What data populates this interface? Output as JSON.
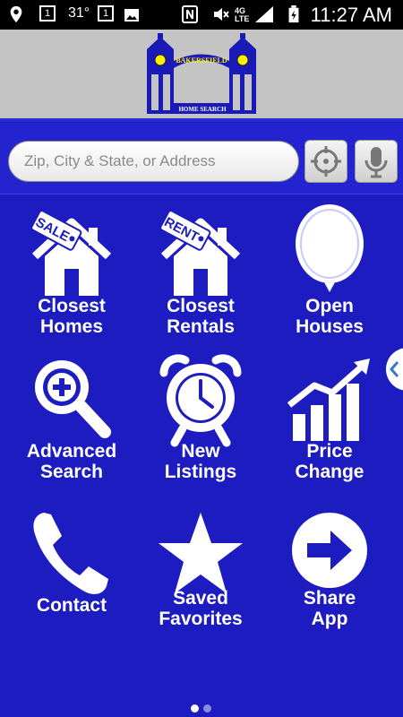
{
  "status_bar": {
    "time": "11:27 AM",
    "temperature": "31°",
    "network": "4G LTE",
    "notification_count_1": "1",
    "notification_count_2": "1",
    "icons": [
      "location-icon",
      "calendar-icon",
      "gallery-icon",
      "nfc-icon",
      "mute-icon",
      "signal-icon",
      "battery-icon"
    ]
  },
  "header": {
    "logo_text_top": "BAKERSFIELD",
    "logo_text_bottom": "HOME SEARCH"
  },
  "search": {
    "placeholder": "Zip, City & State, or Address",
    "locate_icon": "crosshair-icon",
    "voice_icon": "microphone-icon"
  },
  "menu": [
    {
      "label": "Closest Homes",
      "lines": [
        "Closest",
        "Homes"
      ],
      "icon": "sale-house-icon",
      "tag": "SALE"
    },
    {
      "label": "Closest Rentals",
      "lines": [
        "Closest",
        "Rentals"
      ],
      "icon": "rent-house-icon",
      "tag": "RENT"
    },
    {
      "label": "Open Houses",
      "lines": [
        "Open",
        "Houses"
      ],
      "icon": "balloon-icon"
    },
    {
      "label": "Advanced Search",
      "lines": [
        "Advanced",
        "Search"
      ],
      "icon": "magnifier-plus-icon"
    },
    {
      "label": "New Listings",
      "lines": [
        "New",
        "Listings"
      ],
      "icon": "alarm-clock-icon"
    },
    {
      "label": "Price Change",
      "lines": [
        "Price",
        "Change"
      ],
      "icon": "rising-chart-icon"
    },
    {
      "label": "Contact",
      "lines": [
        "Contact"
      ],
      "icon": "phone-icon"
    },
    {
      "label": "Saved Favorites",
      "lines": [
        "Saved",
        "Favorites"
      ],
      "icon": "star-icon"
    },
    {
      "label": "Share App",
      "lines": [
        "Share",
        "App"
      ],
      "icon": "arrow-circle-icon"
    }
  ],
  "pager": {
    "pages": 2,
    "current": 1
  },
  "colors": {
    "background": "#1c1cc0",
    "header_bg": "#c4c4c4",
    "search_bar_bg": "#2323cf",
    "icon_fill": "#ffffff",
    "accent_blue": "#1a1ab8"
  }
}
